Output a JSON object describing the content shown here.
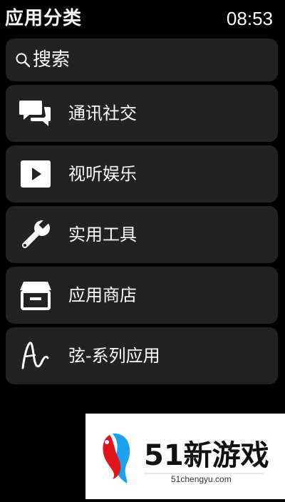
{
  "header": {
    "title": "应用分类",
    "time": "08:53"
  },
  "search": {
    "label": "搜索",
    "icon": "search-icon"
  },
  "categories": [
    {
      "label": "通讯社交",
      "icon": "chat-bubbles-icon"
    },
    {
      "label": "视听娱乐",
      "icon": "play-icon"
    },
    {
      "label": "实用工具",
      "icon": "wrench-icon"
    },
    {
      "label": "应用商店",
      "icon": "store-icon"
    },
    {
      "label": "弦-系列应用",
      "icon": "xian-logo-icon"
    }
  ],
  "watermark": {
    "brand_text": "51新游戏",
    "domain": "51chengyu.com"
  },
  "colors": {
    "background": "#000000",
    "card": "#222222",
    "text": "#ffffff",
    "watermark_red": "#e3141b",
    "watermark_blue": "#1da1e8"
  }
}
